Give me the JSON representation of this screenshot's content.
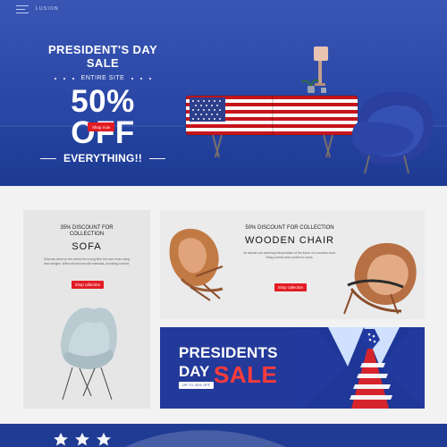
{
  "header": {
    "brand": "LUSION",
    "menu_icon": "menu-icon"
  },
  "hero": {
    "title": "PRESIDENT'S DAY SALE",
    "subtitle": "ENTIRE SITE",
    "headline": "50% OFF",
    "everything": "EVERYTHING!!",
    "button_label": "Shop now",
    "colors": {
      "background": "#2a47a6",
      "cta": "#e31b23"
    }
  },
  "cards": {
    "sofa": {
      "kicker": "35% DISCOUNT FOR COLLECTION",
      "title": "SOFA",
      "description": "Sofa has been on the school for a long time but now it has many new designs. With soft and smooth materials, providing comfort.",
      "button_label": "Shop collection"
    },
    "wooden_chair": {
      "kicker": "50% DISCOUNT FOR COLLECTION",
      "title": "WOODEN CHAIR",
      "description": "An almost eye-catching interpretation of the future of a wooden chair. Bring comfort and comfort to users.",
      "button_label": "Shop collection"
    },
    "presidents_day": {
      "line1": "PRESIDENTS",
      "line2": "DAY",
      "sale": "SALE",
      "tag": "UP TO 40% OFF"
    }
  }
}
